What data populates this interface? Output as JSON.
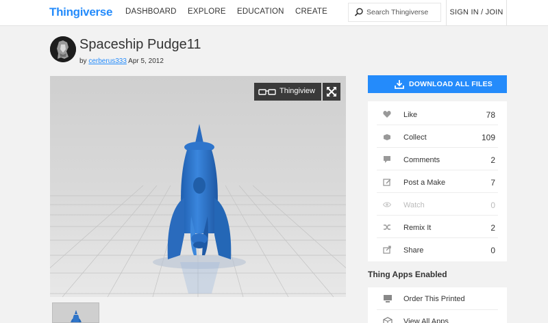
{
  "header": {
    "logo": "Thingiverse",
    "nav": [
      "DASHBOARD",
      "EXPLORE",
      "EDUCATION",
      "CREATE"
    ],
    "search_placeholder": "Search Thingiverse",
    "signin": "SIGN IN / JOIN"
  },
  "thing": {
    "title": "Spaceship Pudge11",
    "by": "by",
    "author": "cerberus333",
    "date": "Apr 5, 2012"
  },
  "viewer": {
    "thingiview_label": "Thingiview"
  },
  "sidebar": {
    "download_label": "DOWNLOAD ALL FILES",
    "stats": [
      {
        "label": "Like",
        "count": "78",
        "icon": "heart-icon"
      },
      {
        "label": "Collect",
        "count": "109",
        "icon": "collect-icon"
      },
      {
        "label": "Comments",
        "count": "2",
        "icon": "comment-icon"
      },
      {
        "label": "Post a Make",
        "count": "7",
        "icon": "post-make-icon"
      },
      {
        "label": "Watch",
        "count": "0",
        "icon": "eye-icon"
      },
      {
        "label": "Remix It",
        "count": "2",
        "icon": "remix-icon"
      },
      {
        "label": "Share",
        "count": "0",
        "icon": "share-icon"
      }
    ],
    "apps_heading": "Thing Apps Enabled",
    "apps": [
      {
        "label": "Order This Printed",
        "icon": "printer-icon"
      },
      {
        "label": "View All Apps",
        "icon": "cube-icon"
      }
    ]
  },
  "colors": {
    "brand": "#248bfb",
    "model": "#2f72c8"
  }
}
